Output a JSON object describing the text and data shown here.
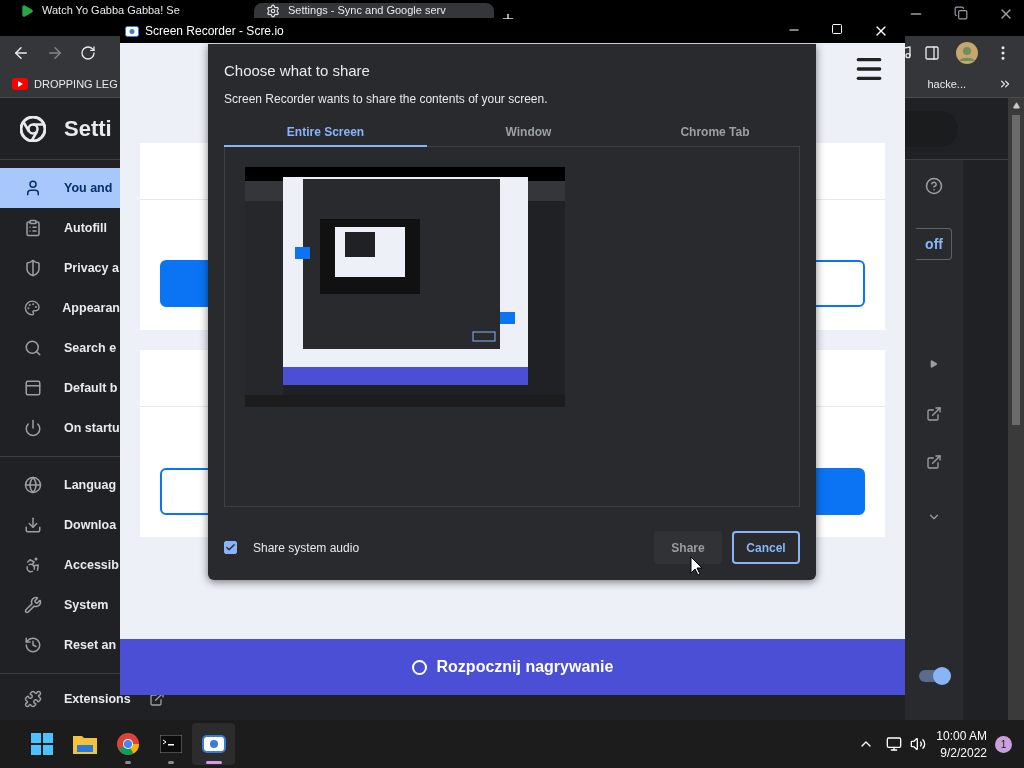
{
  "browser": {
    "tabs": [
      {
        "title": "Watch Yo Gabba Gabba! Se",
        "selected": false
      },
      {
        "title": "Settings - Sync and Google serv",
        "selected": true
      }
    ],
    "bookmarks": {
      "left": "DROPPING LEG",
      "right": "hacke..."
    },
    "settings_title": "Setti",
    "sidebar": {
      "groups": [
        [
          {
            "label": "You and",
            "selected": true
          },
          {
            "label": "Autofill",
            "selected": false
          },
          {
            "label": "Privacy a",
            "selected": false
          },
          {
            "label": "Appearan",
            "selected": false
          },
          {
            "label": "Search e",
            "selected": false
          },
          {
            "label": "Default b",
            "selected": false
          },
          {
            "label": "On startu",
            "selected": false
          }
        ],
        [
          {
            "label": "Languag",
            "selected": false
          },
          {
            "label": "Downloa",
            "selected": false
          },
          {
            "label": "Accessib",
            "selected": false
          },
          {
            "label": "System",
            "selected": false
          },
          {
            "label": "Reset an",
            "selected": false
          }
        ],
        [
          {
            "label": "Extensions",
            "selected": false
          }
        ]
      ]
    },
    "off_button": "off",
    "toggle": {
      "on": true
    }
  },
  "recorder": {
    "title": "Screen Recorder - Scre.io",
    "dialog": {
      "title": "Choose what to share",
      "message": "Screen Recorder wants to share the contents of your screen.",
      "tabs": [
        {
          "label": "Entire Screen",
          "selected": true
        },
        {
          "label": "Window",
          "selected": false
        },
        {
          "label": "Chrome Tab",
          "selected": false
        }
      ],
      "audio": {
        "label": "Share system audio",
        "checked": true
      },
      "share_button": {
        "label": "Share",
        "disabled": true
      },
      "cancel_button": "Cancel"
    },
    "start_button": "Rozpocznij nagrywanie"
  },
  "taskbar": {
    "apps": [
      {
        "open": false,
        "selected": false
      },
      {
        "open": false,
        "selected": false
      },
      {
        "open": true,
        "selected": false
      },
      {
        "open": true,
        "selected": false
      },
      {
        "open": true,
        "selected": true
      }
    ],
    "time": "10:00 AM",
    "date": "9/2/2022",
    "notifications": "1"
  }
}
